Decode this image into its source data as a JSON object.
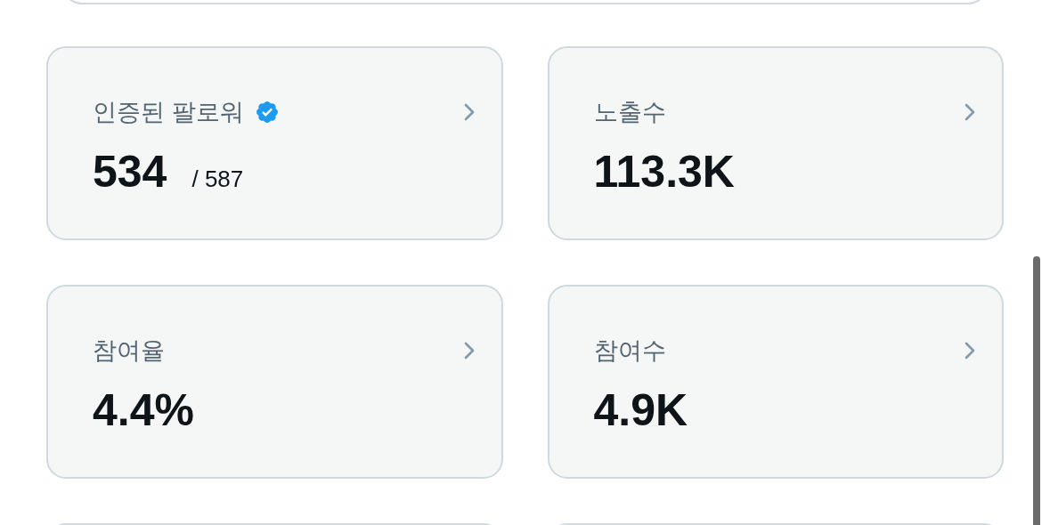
{
  "cards": [
    {
      "label": "인증된 팔로워",
      "verified": true,
      "value": "534",
      "total": "/ 587"
    },
    {
      "label": "노출수",
      "verified": false,
      "value": "113.3K"
    },
    {
      "label": "참여율",
      "verified": false,
      "value": "4.4%"
    },
    {
      "label": "참여수",
      "verified": false,
      "value": "4.9K"
    }
  ]
}
